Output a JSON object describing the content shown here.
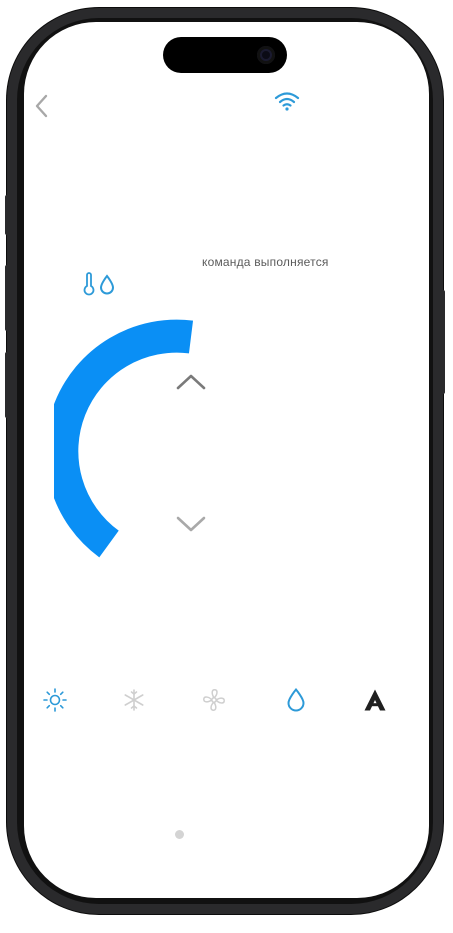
{
  "status": {
    "message": "команда выполняется"
  },
  "header": {
    "back_icon": "chevron-left-icon",
    "wifi_icon": "wifi-icon"
  },
  "indicators": {
    "icons": [
      "thermometer-icon",
      "droplet-icon"
    ]
  },
  "dial": {
    "level": 0.42,
    "up_icon": "chevron-up-icon",
    "down_icon": "chevron-down-icon"
  },
  "modes": [
    {
      "icon": "sun-icon",
      "label": "heat",
      "state": "active"
    },
    {
      "icon": "snowflake-icon",
      "label": "cool",
      "state": "inactive"
    },
    {
      "icon": "fan-icon",
      "label": "fan",
      "state": "inactive"
    },
    {
      "icon": "droplet-icon",
      "label": "dry",
      "state": "selected"
    },
    {
      "icon": "auto-icon",
      "label": "auto",
      "state": "inactive"
    }
  ],
  "pagination": {
    "current": 1,
    "total": 1
  },
  "colors": {
    "accent": "#0a8ff5",
    "icon_blue": "#2d9ad8",
    "muted": "#cfcfcf",
    "chevron": "#7a7a7a",
    "dark": "#1f1f1f"
  }
}
